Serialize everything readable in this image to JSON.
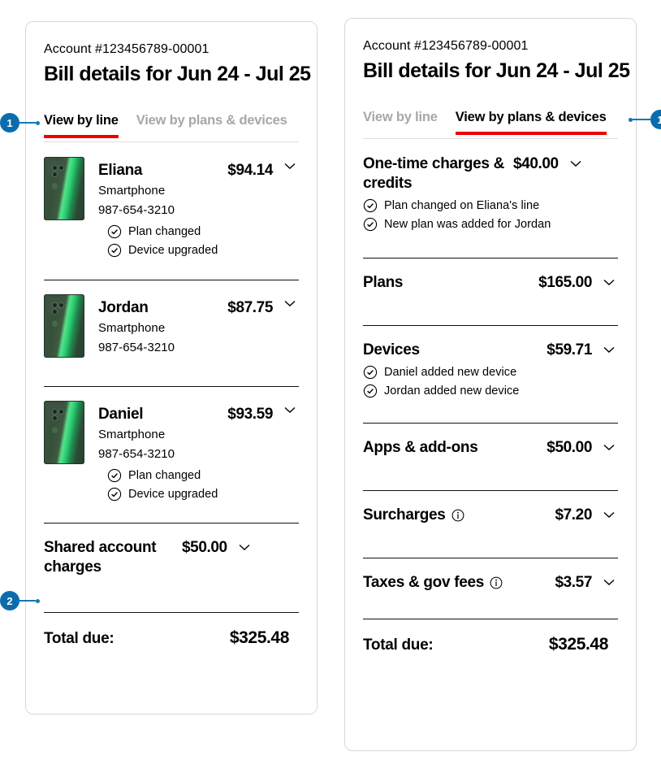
{
  "colors": {
    "accent_red": "#EE0000",
    "callout_blue": "#0B6CAD",
    "muted_text": "#A7A7A7",
    "card_border": "#D8D8D8"
  },
  "callouts": [
    {
      "number": "1",
      "target": "view-by-line-tab"
    },
    {
      "number": "2",
      "target": "shared-account-charges-row"
    },
    {
      "number": "1",
      "target": "view-by-plans-devices-tab"
    }
  ],
  "left_card": {
    "account": "Account #123456789-00001",
    "title": "Bill details for Jun 24 - Jul 25",
    "tabs": [
      {
        "label": "View by line",
        "active": true
      },
      {
        "label": "View by plans & devices",
        "active": false
      }
    ],
    "lines": [
      {
        "name": "Eliana",
        "device_type": "Smartphone",
        "phone": "987-654-3210",
        "amount": "$94.14",
        "badges": [
          "Plan changed",
          "Device upgraded"
        ]
      },
      {
        "name": "Jordan",
        "device_type": "Smartphone",
        "phone": "987-654-3210",
        "amount": "$87.75",
        "badges": []
      },
      {
        "name": "Daniel",
        "device_type": "Smartphone",
        "phone": "987-654-3210",
        "amount": "$93.59",
        "badges": [
          "Plan changed",
          "Device upgraded"
        ]
      }
    ],
    "shared": {
      "label": "Shared account charges",
      "amount": "$50.00"
    },
    "total": {
      "label": "Total due:",
      "amount": "$325.48"
    }
  },
  "right_card": {
    "account": "Account #123456789-00001",
    "title": "Bill details for Jun 24 - Jul 25",
    "tabs": [
      {
        "label": "View by line",
        "active": false
      },
      {
        "label": "View by plans & devices",
        "active": true
      }
    ],
    "sections": [
      {
        "label": "One-time charges & credits",
        "amount": "$40.00",
        "info": false,
        "badges": [
          "Plan changed on Eliana's line",
          "New plan was added for Jordan"
        ]
      },
      {
        "label": "Plans",
        "amount": "$165.00",
        "info": false,
        "badges": []
      },
      {
        "label": "Devices",
        "amount": "$59.71",
        "info": false,
        "badges": [
          "Daniel added new device",
          "Jordan added new device"
        ]
      },
      {
        "label": "Apps & add-ons",
        "amount": "$50.00",
        "info": false,
        "badges": []
      },
      {
        "label": "Surcharges",
        "amount": "$7.20",
        "info": true,
        "badges": []
      },
      {
        "label": "Taxes & gov fees",
        "amount": "$3.57",
        "info": true,
        "badges": []
      }
    ],
    "total": {
      "label": "Total due:",
      "amount": "$325.48"
    }
  },
  "icons": {
    "chevron": "chevron-down-icon",
    "check": "check-circle-icon",
    "info": "info-circle-icon"
  }
}
